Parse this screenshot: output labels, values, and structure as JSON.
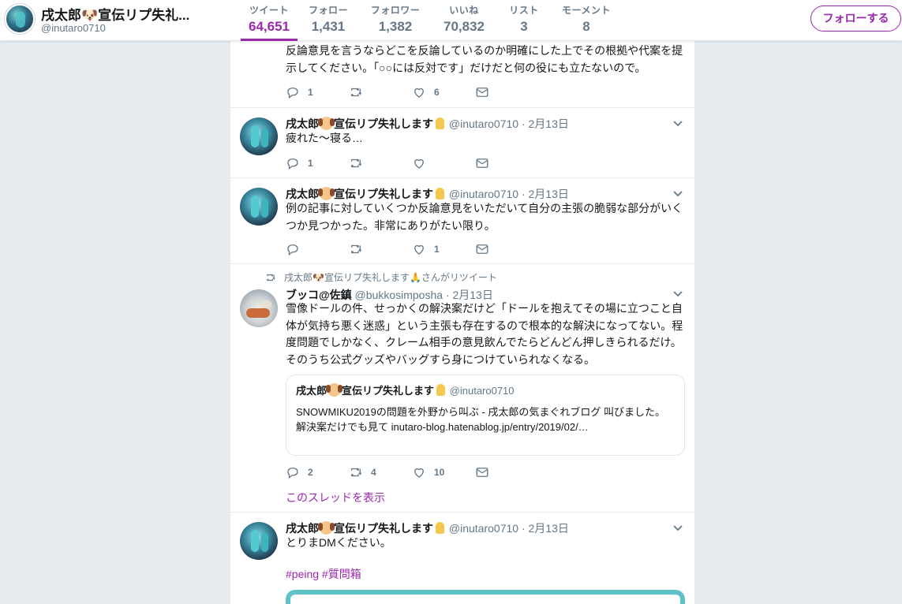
{
  "header": {
    "display_name": "戌太郎🐶宣伝リプ失礼...",
    "handle": "@inutaro0710",
    "stats": [
      {
        "label": "ツイート",
        "value": "64,651",
        "active": true
      },
      {
        "label": "フォロー",
        "value": "1,431"
      },
      {
        "label": "フォロワー",
        "value": "1,382"
      },
      {
        "label": "いいね",
        "value": "70,832"
      },
      {
        "label": "リスト",
        "value": "3"
      },
      {
        "label": "モーメント",
        "value": "8"
      }
    ],
    "follow_button": "フォローする"
  },
  "colors": {
    "accent": "#9c27b0",
    "muted": "#657786",
    "background": "#e6ecf0"
  },
  "tweets": [
    {
      "text": "反論意見を言うならどこを反論しているのか明確にした上でその根拠や代案を提示してください。「○○には反対です」だけだと何の役にも立たないので。",
      "replies": "1",
      "retweets": "",
      "likes": "6"
    },
    {
      "author": "戌太郎",
      "author_suffix": "宣伝リプ失礼します",
      "handle": "@inutaro0710",
      "date": "· 2月13日",
      "text": "疲れた～寝る…",
      "replies": "1",
      "retweets": "",
      "likes": ""
    },
    {
      "author": "戌太郎",
      "author_suffix": "宣伝リプ失礼します",
      "handle": "@inutaro0710",
      "date": "· 2月13日",
      "text": "例の記事に対していくつか反論意見をいただいて自分の主張の脆弱な部分がいくつか見つかった。非常にありがたい限り。",
      "replies": "",
      "retweets": "",
      "likes": "1"
    },
    {
      "retweeted_by": "戌太郎🐶宣伝リプ失礼します🙏さんがリツイート",
      "author": "ブッコ@佐鎮",
      "handle": "@bukkosimposha",
      "date": "· 2月13日",
      "text": "雪像ドールの件、せっかくの解決案だけど「ドールを抱えてその場に立つこと自体が気持ち悪く迷惑」という主張も存在するので根本的な解決になってない。程度問題でしかなく、クレーム相手の意見飲んでたらどんどん押しきられるだけ。そのうち公式グッズやバッグすら身につけていられなくなる。",
      "quote": {
        "author": "戌太郎",
        "author_suffix": "宣伝リプ失礼します",
        "handle": "@inutaro0710",
        "text": "SNOWMIKU2019の問題を外野から叫ぶ - 戌太郎の気まぐれブログ 叫びました。解決案だけでも見て inutaro-blog.hatenablog.jp/entry/2019/02/…"
      },
      "replies": "2",
      "retweets": "4",
      "likes": "10",
      "thread_link": "このスレッドを表示"
    },
    {
      "author": "戌太郎",
      "author_suffix": "宣伝リプ失礼します",
      "handle": "@inutaro0710",
      "date": "· 2月13日",
      "text": "とりまDMください。",
      "hashtags": "#peing #質問箱"
    }
  ]
}
